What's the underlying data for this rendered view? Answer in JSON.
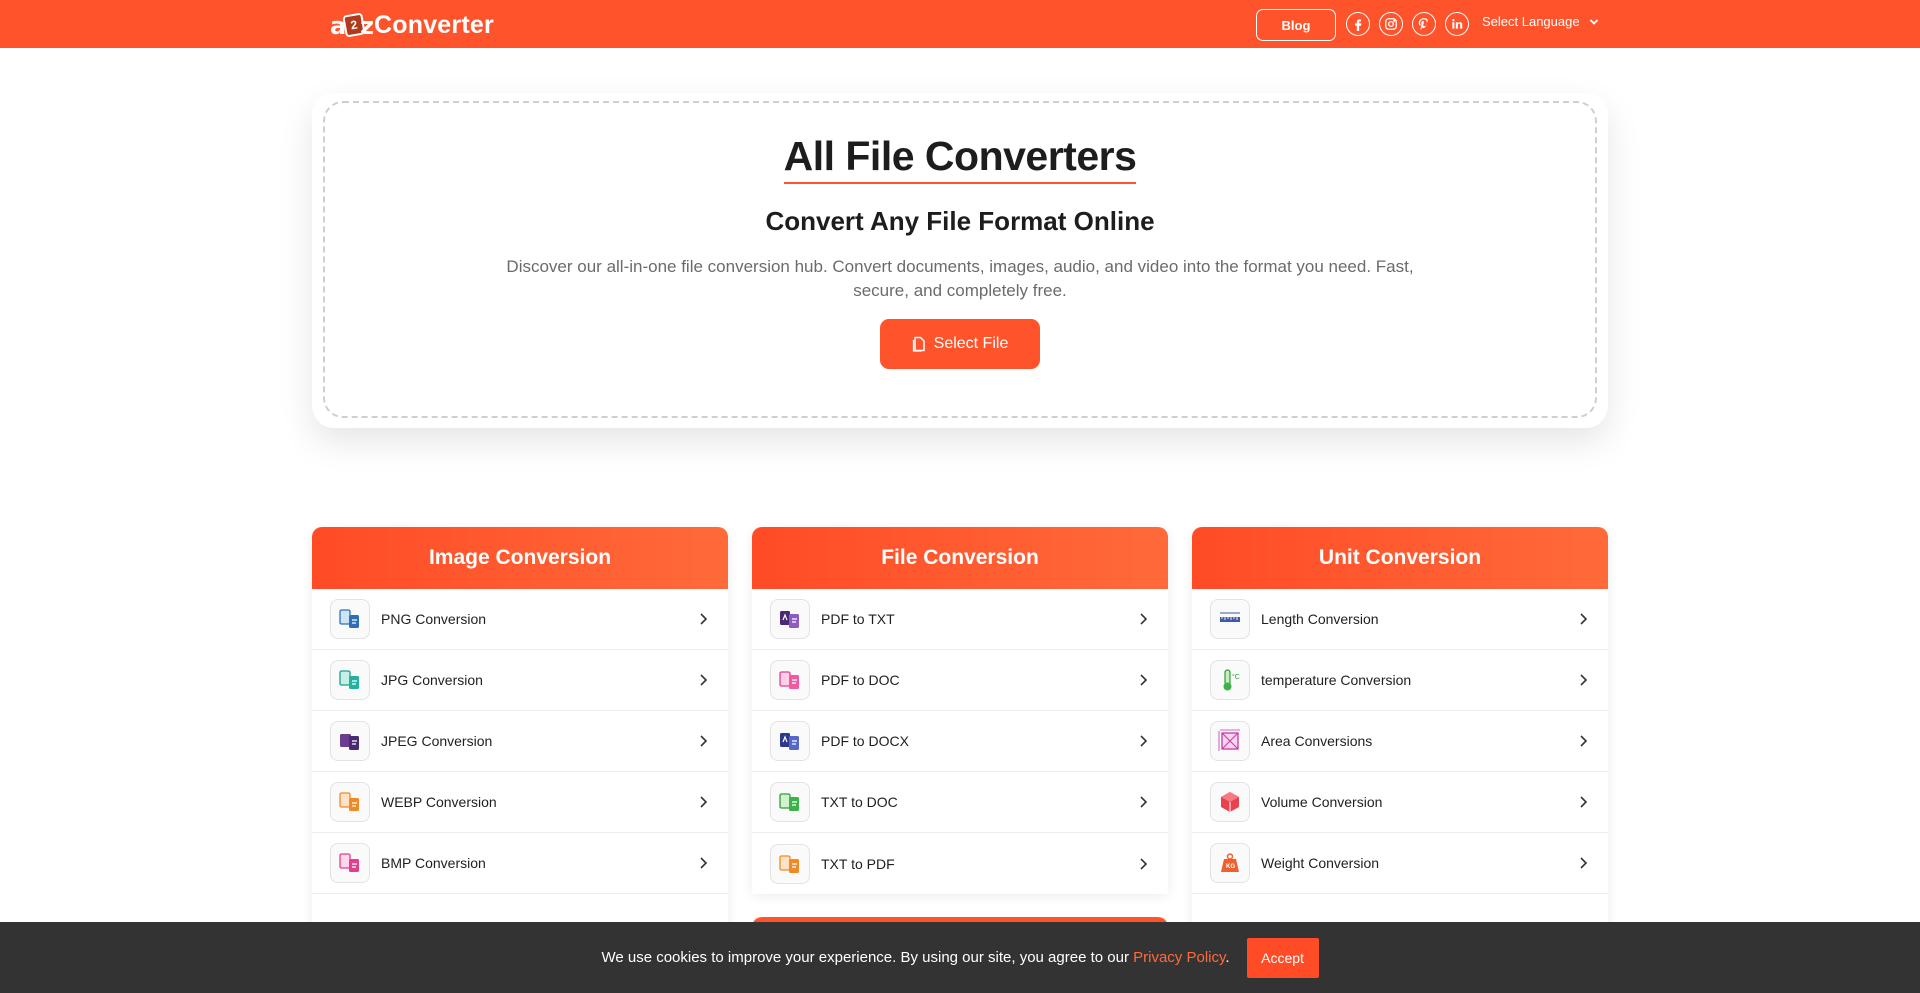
{
  "header": {
    "logo_text": "Converter",
    "logo_letters": {
      "a": "a",
      "badge": "2",
      "z": "z"
    },
    "blog_label": "Blog",
    "social": [
      "facebook-icon",
      "instagram-icon",
      "pinterest-icon",
      "linkedin-icon"
    ],
    "language_label": "Select Language"
  },
  "hero": {
    "title": "All File Converters",
    "subtitle": "Convert Any File Format Online",
    "description": "Discover our all-in-one file conversion hub. Convert documents, images, audio, and video into the format you need. Fast, secure, and completely free.",
    "button_label": "Select File"
  },
  "columns": [
    {
      "title": "Image Conversion",
      "items": [
        {
          "label": "PNG Conversion",
          "icon": "png-file-icon"
        },
        {
          "label": "JPG Conversion",
          "icon": "jpg-file-icon"
        },
        {
          "label": "JPEG Conversion",
          "icon": "jpeg-file-icon"
        },
        {
          "label": "WEBP Conversion",
          "icon": "webp-file-icon"
        },
        {
          "label": "BMP Conversion",
          "icon": "bmp-file-icon"
        }
      ]
    },
    {
      "title": "File Conversion",
      "items": [
        {
          "label": "PDF to TXT",
          "icon": "pdf-to-txt-icon"
        },
        {
          "label": "PDF to DOC",
          "icon": "pdf-to-doc-icon"
        },
        {
          "label": "PDF to DOCX",
          "icon": "pdf-to-docx-icon"
        },
        {
          "label": "TXT to DOC",
          "icon": "txt-to-doc-icon"
        },
        {
          "label": "TXT to PDF",
          "icon": "txt-to-pdf-icon"
        }
      ]
    },
    {
      "title": "Unit Conversion",
      "items": [
        {
          "label": "Length Conversion",
          "icon": "ruler-icon"
        },
        {
          "label": "temperature Conversion",
          "icon": "thermometer-icon"
        },
        {
          "label": "Area Conversions",
          "icon": "area-icon"
        },
        {
          "label": "Volume Conversion",
          "icon": "cube-icon"
        },
        {
          "label": "Weight Conversion",
          "icon": "weight-icon"
        }
      ]
    }
  ],
  "cookie": {
    "text_before": "We use cookies to improve your experience. By using our site, you agree to our ",
    "link_label": "Privacy Policy",
    "text_after": ".",
    "accept_label": "Accept"
  },
  "colors": {
    "brand": "#ff532c",
    "cookie_bg": "#333333",
    "link": "#ff6a3a"
  }
}
